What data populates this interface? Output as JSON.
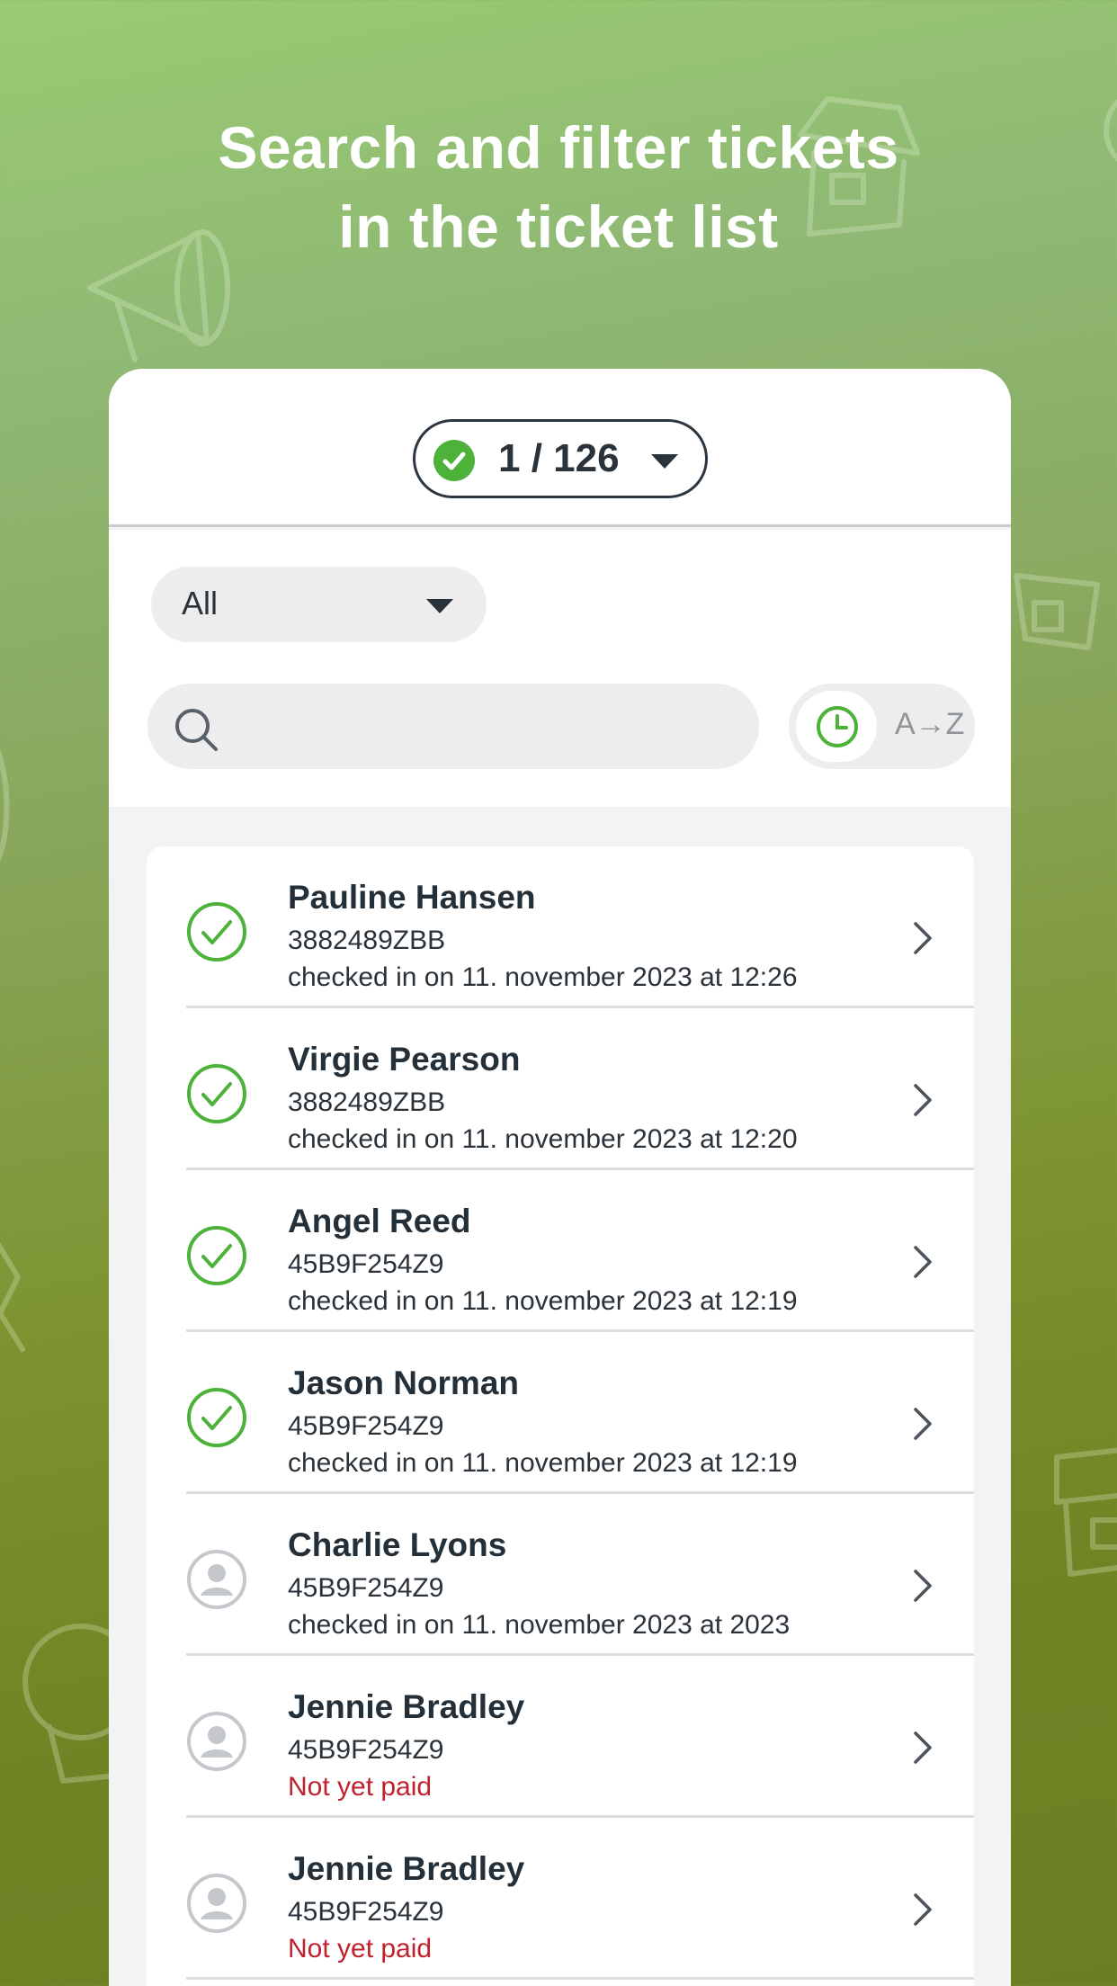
{
  "headline": {
    "line1": "Search and filter tickets",
    "line2": "in the ticket list"
  },
  "counter": {
    "text": "1 / 126"
  },
  "filter": {
    "selected": "All"
  },
  "search": {
    "placeholder": "",
    "value": ""
  },
  "sort": {
    "az_label": "A→Z"
  },
  "colors": {
    "checked_in": "#4db23a",
    "unpaid": "#c0212c"
  },
  "tickets": [
    {
      "name": "Pauline Hansen",
      "code": "3882489ZBB",
      "note": "checked in on 11. november 2023 at 12:26",
      "status": "checked-in"
    },
    {
      "name": "Virgie Pearson",
      "code": "3882489ZBB",
      "note": "checked in on 11. november 2023 at 12:20",
      "status": "checked-in"
    },
    {
      "name": "Angel Reed",
      "code": "45B9F254Z9",
      "note": "checked in on 11. november 2023 at 12:19",
      "status": "checked-in"
    },
    {
      "name": "Jason Norman",
      "code": "45B9F254Z9",
      "note": "checked in on 11. november 2023 at  12:19",
      "status": "checked-in"
    },
    {
      "name": "Charlie Lyons",
      "code": "45B9F254Z9",
      "note": "checked in on 11. november 2023 at  2023",
      "status": "person"
    },
    {
      "name": "Jennie Bradley",
      "code": "45B9F254Z9",
      "note": "Not yet paid",
      "status": "unpaid"
    },
    {
      "name": "Jennie Bradley",
      "code": "45B9F254Z9",
      "note": "Not yet paid",
      "status": "unpaid"
    }
  ]
}
